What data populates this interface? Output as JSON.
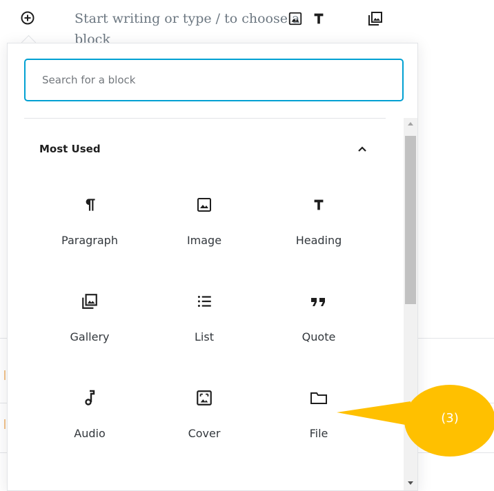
{
  "editor": {
    "placeholder": "Start writing or type / to choose a block"
  },
  "inserter": {
    "search_placeholder": "Search for a block",
    "panel": {
      "title": "Most Used",
      "expanded": true
    },
    "blocks": [
      {
        "label": "Paragraph",
        "icon": "paragraph-icon"
      },
      {
        "label": "Image",
        "icon": "image-icon"
      },
      {
        "label": "Heading",
        "icon": "heading-icon"
      },
      {
        "label": "Gallery",
        "icon": "gallery-icon"
      },
      {
        "label": "List",
        "icon": "list-icon"
      },
      {
        "label": "Quote",
        "icon": "quote-icon"
      },
      {
        "label": "Audio",
        "icon": "audio-icon"
      },
      {
        "label": "Cover",
        "icon": "cover-icon"
      },
      {
        "label": "File",
        "icon": "file-icon"
      }
    ]
  },
  "callout": {
    "label": "(3)",
    "color": "#ffc000"
  },
  "colors": {
    "accent": "#00a0d2",
    "text": "#1e1e1e",
    "muted": "#6c7781"
  }
}
